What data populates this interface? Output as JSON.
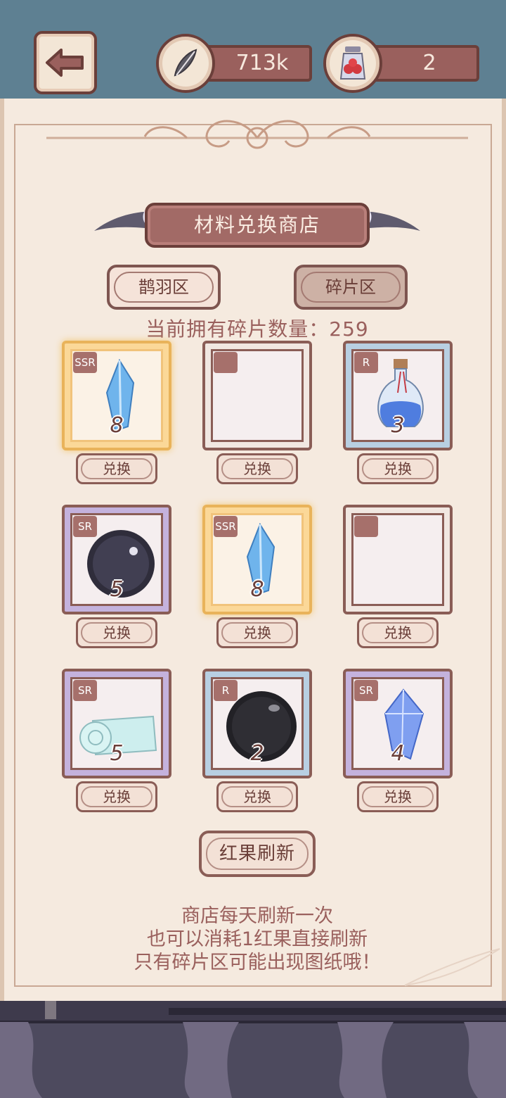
{
  "resources": {
    "feather_amount": "713k",
    "berry_amount": "2"
  },
  "shop": {
    "title": "材料兑换商店",
    "tabs": [
      {
        "label": "鹊羽区",
        "active": false
      },
      {
        "label": "碎片区",
        "active": true
      }
    ],
    "fragment_count_text": "当前拥有碎片数量：259",
    "items": [
      {
        "rarity": "SSR",
        "icon": "blue-crystal-icon",
        "qty": "8",
        "button": "兑换"
      },
      {
        "rarity": "",
        "icon": "",
        "qty": "",
        "button": "兑换"
      },
      {
        "rarity": "R",
        "icon": "potion-bottle-icon",
        "qty": "3",
        "button": "兑换"
      },
      {
        "rarity": "SR",
        "icon": "dark-orb-icon",
        "qty": "5",
        "button": "兑换"
      },
      {
        "rarity": "SSR",
        "icon": "blue-crystal-icon",
        "qty": "8",
        "button": "兑换"
      },
      {
        "rarity": "",
        "icon": "",
        "qty": "",
        "button": "兑换"
      },
      {
        "rarity": "SR",
        "icon": "cloth-roll-icon",
        "qty": "5",
        "button": "兑换"
      },
      {
        "rarity": "R",
        "icon": "black-orb-icon",
        "qty": "2",
        "button": "兑换"
      },
      {
        "rarity": "SR",
        "icon": "ice-crystal-icon",
        "qty": "4",
        "button": "兑换"
      }
    ],
    "refresh_button": "红果刷新",
    "notes": [
      "商店每天刷新一次",
      "也可以消耗1红果直接刷新",
      "只有碎片区可能出现图纸哦！"
    ]
  },
  "colors": {
    "accent": "#9a605d",
    "border": "#6b3f3a",
    "ssr": "#fbd898",
    "sr": "#c4b2dd",
    "r": "#b8cfe2"
  }
}
